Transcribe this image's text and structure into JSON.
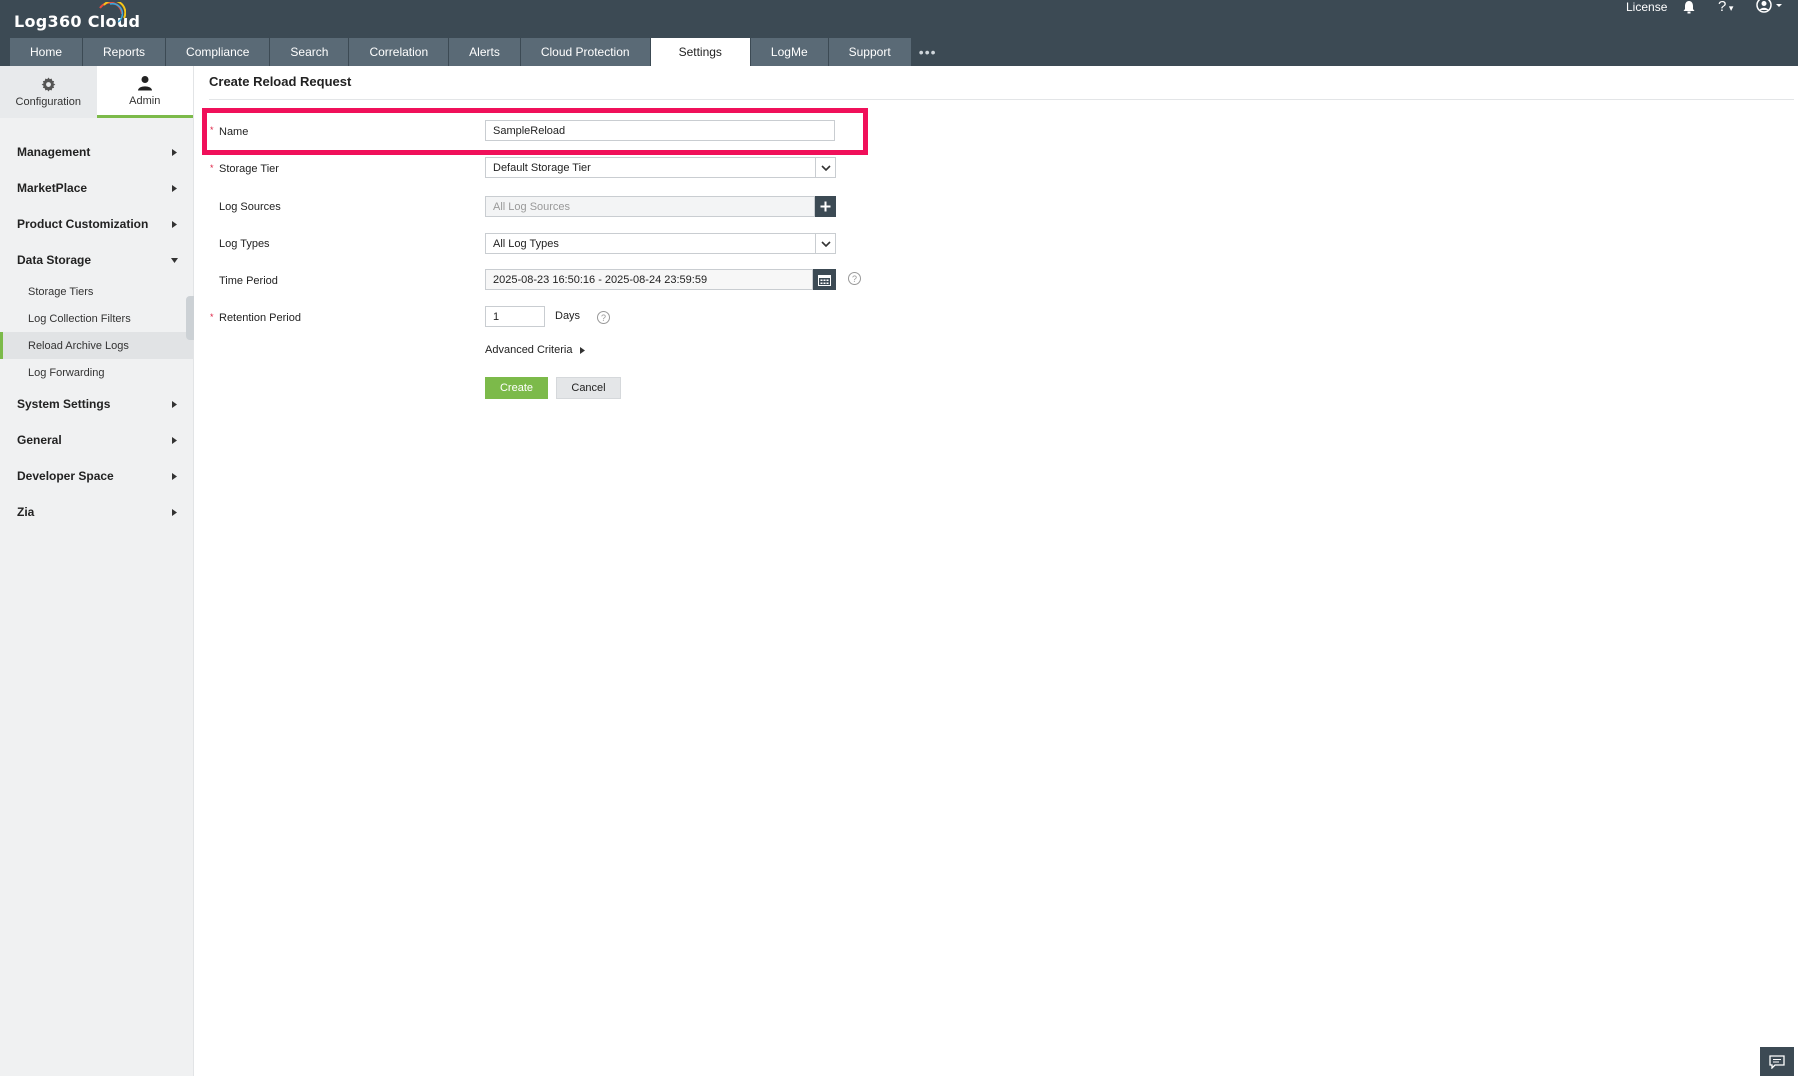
{
  "app": {
    "logo_text": "Log360  Cloud",
    "license_link": "License",
    "help_label": "?"
  },
  "tabs": [
    {
      "label": "Home"
    },
    {
      "label": "Reports"
    },
    {
      "label": "Compliance"
    },
    {
      "label": "Search"
    },
    {
      "label": "Correlation"
    },
    {
      "label": "Alerts"
    },
    {
      "label": "Cloud Protection"
    },
    {
      "label": "Settings"
    },
    {
      "label": "LogMe"
    },
    {
      "label": "Support"
    }
  ],
  "tab_more": "•••",
  "sidebar": {
    "tabs": [
      {
        "label": "Configuration",
        "icon": "gear-icon"
      },
      {
        "label": "Admin",
        "icon": "user-icon"
      }
    ],
    "groups": [
      {
        "label": "Management"
      },
      {
        "label": "MarketPlace"
      },
      {
        "label": "Product Customization"
      },
      {
        "label": "Data Storage"
      },
      {
        "label": "System Settings"
      },
      {
        "label": "General"
      },
      {
        "label": "Developer Space"
      },
      {
        "label": "Zia"
      }
    ],
    "data_storage_items": [
      {
        "label": "Storage Tiers"
      },
      {
        "label": "Log Collection Filters"
      },
      {
        "label": "Reload Archive Logs"
      },
      {
        "label": "Log Forwarding"
      }
    ]
  },
  "form": {
    "title": "Create Reload Request",
    "required_mark": "*",
    "name_label": "Name",
    "name_value": "SampleReload",
    "storage_tier_label": "Storage Tier",
    "storage_tier_value": "Default Storage Tier",
    "log_sources_label": "Log Sources",
    "log_sources_placeholder": "All Log Sources",
    "log_types_label": "Log Types",
    "log_types_value": "All Log Types",
    "time_period_label": "Time Period",
    "time_period_value": "2025-08-23 16:50:16 - 2025-08-24 23:59:59",
    "retention_label": "Retention Period",
    "retention_value": "1",
    "retention_unit": "Days",
    "advanced_criteria": "Advanced Criteria",
    "create_button": "Create",
    "cancel_button": "Cancel"
  },
  "colors": {
    "header": "#3c4a54",
    "accent_green": "#7cba4a",
    "highlight": "#f0105a"
  }
}
